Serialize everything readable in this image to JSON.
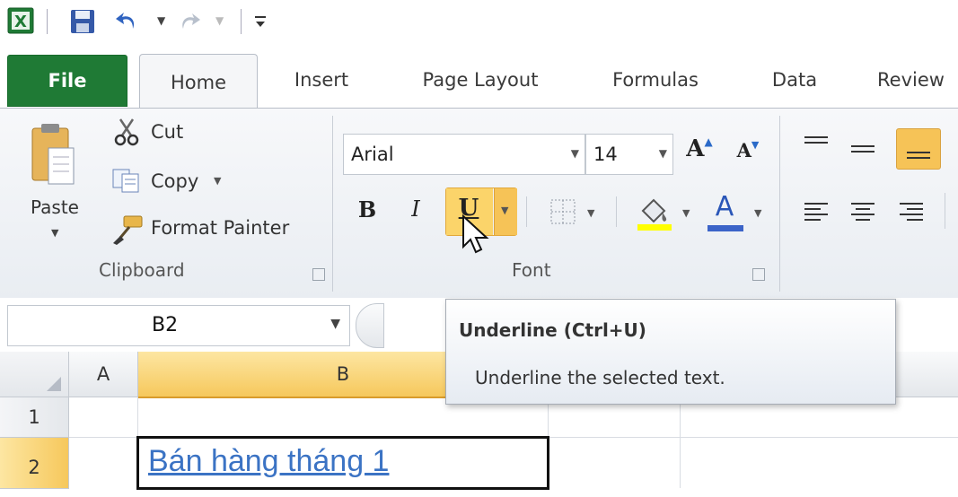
{
  "quick_access": {
    "icons": [
      "excel-logo-icon",
      "save-icon",
      "undo-icon",
      "redo-icon",
      "customize-qat-icon"
    ]
  },
  "tabs": {
    "file": "File",
    "home": "Home",
    "insert": "Insert",
    "page_layout": "Page Layout",
    "formulas": "Formulas",
    "data": "Data",
    "review": "Review"
  },
  "clipboard": {
    "paste": "Paste",
    "cut": "Cut",
    "copy": "Copy",
    "format_painter": "Format Painter",
    "group_label": "Clipboard"
  },
  "font": {
    "font_name": "Arial",
    "font_size": "14",
    "bold": "B",
    "italic": "I",
    "underline": "U",
    "font_color_letter": "A",
    "grow_letter": "A",
    "shrink_letter": "A",
    "group_label": "Font",
    "fill_color": "#ffff00",
    "font_color": "#3c64c8",
    "underline_highlight": "#fbd46a"
  },
  "formula_bar": {
    "name_box": "B2"
  },
  "sheet": {
    "columns": [
      "A",
      "B"
    ],
    "rows": [
      "1",
      "2"
    ],
    "cell_b2": "Bán hàng tháng 1",
    "cell_b2_color": "#3b73c4"
  },
  "tooltip": {
    "title": "Underline (Ctrl+U)",
    "description": "Underline the selected text."
  }
}
